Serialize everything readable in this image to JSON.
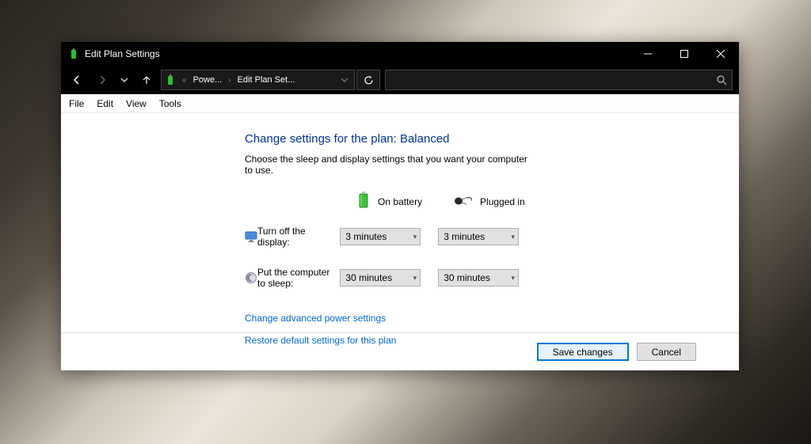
{
  "titlebar": {
    "title": "Edit Plan Settings"
  },
  "breadcrumb": {
    "seg1": "Powe...",
    "seg2": "Edit Plan Set..."
  },
  "menubar": {
    "file": "File",
    "edit": "Edit",
    "view": "View",
    "tools": "Tools"
  },
  "main": {
    "heading": "Change settings for the plan: Balanced",
    "desc": "Choose the sleep and display settings that you want your computer to use.",
    "columns": {
      "battery": "On battery",
      "plugged": "Plugged in"
    },
    "rows": {
      "display": {
        "label": "Turn off the display:",
        "battery": "3 minutes",
        "plugged": "3 minutes"
      },
      "sleep": {
        "label": "Put the computer to sleep:",
        "battery": "30 minutes",
        "plugged": "30 minutes"
      }
    },
    "links": {
      "advanced": "Change advanced power settings",
      "restore": "Restore default settings for this plan"
    }
  },
  "footer": {
    "save": "Save changes",
    "cancel": "Cancel"
  }
}
